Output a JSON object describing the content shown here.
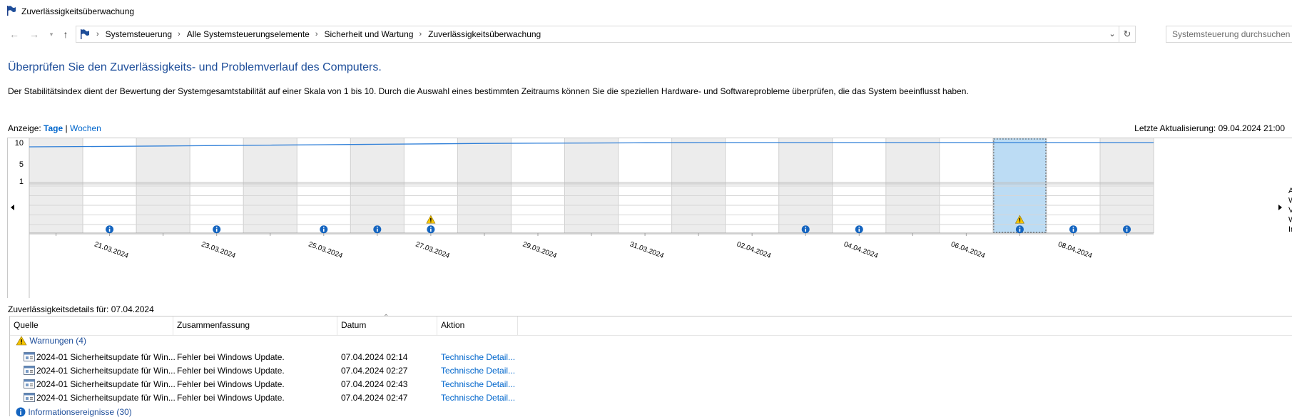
{
  "window": {
    "title": "Zuverlässigkeitsüberwachung"
  },
  "address": {
    "crumbs": [
      "Systemsteuerung",
      "Alle Systemsteuerungselemente",
      "Sicherheit und Wartung",
      "Zuverlässigkeitsüberwachung"
    ],
    "search_placeholder": "Systemsteuerung durchsuchen"
  },
  "page": {
    "heading": "Überprüfen Sie den Zuverlässigkeits- und Problemverlauf des Computers.",
    "description": "Der Stabilitätsindex dient der Bewertung der Systemgesamtstabilität auf einer Skala von 1 bis 10. Durch die Auswahl eines bestimmten Zeitraums können Sie die speziellen Hardware- und Softwareprobleme überprüfen, die das System beeinflusst haben.",
    "view_label": "Anzeige:",
    "view_days": "Tage",
    "view_sep": "|",
    "view_weeks": "Wochen",
    "last_update": "Letzte Aktualisierung: 09.04.2024 21:00"
  },
  "chart_data": {
    "type": "line",
    "title": "",
    "ylim": [
      1,
      10
    ],
    "y_ticks": [
      "10",
      "5",
      "1"
    ],
    "x_tick_labels": [
      "21.03.2024",
      "23.03.2024",
      "25.03.2024",
      "27.03.2024",
      "29.03.2024",
      "31.03.2024",
      "02.04.2024",
      "04.04.2024",
      "06.04.2024",
      "08.04.2024"
    ],
    "days": [
      "20.03",
      "21.03",
      "22.03",
      "23.03",
      "24.03",
      "25.03",
      "26.03",
      "27.03",
      "28.03",
      "29.03",
      "30.03",
      "31.03",
      "01.04",
      "02.04",
      "03.04",
      "04.04",
      "05.04",
      "06.04",
      "07.04",
      "08.04",
      "09.04"
    ],
    "stability_index": [
      9.0,
      9.1,
      9.2,
      9.3,
      9.4,
      9.5,
      9.6,
      9.7,
      9.8,
      9.85,
      9.9,
      9.95,
      10,
      10,
      10,
      10,
      10,
      10,
      10,
      10,
      10
    ],
    "selected_day": "07.04",
    "warning_days": [
      "27.03",
      "07.04"
    ],
    "info_days": [
      "21.03",
      "23.03",
      "25.03",
      "26.03",
      "27.03",
      "03.04",
      "04.04",
      "07.04",
      "08.04",
      "09.04"
    ],
    "row_labels_right": [
      "A",
      "W",
      "V",
      "W",
      "In"
    ]
  },
  "details": {
    "label": "Zuverlässigkeitsdetails für: 07.04.2024",
    "columns": [
      "Quelle",
      "Zusammenfassung",
      "Datum",
      "Aktion"
    ],
    "warnings_group": "Warnungen (4)",
    "rows": [
      {
        "source": "2024-01 Sicherheitsupdate für Win...",
        "summary": "Fehler bei Windows Update.",
        "date": "07.04.2024 02:14",
        "action": "Technische Detail..."
      },
      {
        "source": "2024-01 Sicherheitsupdate für Win...",
        "summary": "Fehler bei Windows Update.",
        "date": "07.04.2024 02:27",
        "action": "Technische Detail..."
      },
      {
        "source": "2024-01 Sicherheitsupdate für Win...",
        "summary": "Fehler bei Windows Update.",
        "date": "07.04.2024 02:43",
        "action": "Technische Detail..."
      },
      {
        "source": "2024-01 Sicherheitsupdate für Win...",
        "summary": "Fehler bei Windows Update.",
        "date": "07.04.2024 02:47",
        "action": "Technische Detail..."
      }
    ],
    "info_group": "Informationsereignisse (30)"
  },
  "colors": {
    "accent": "#1e4e9a",
    "link": "#0066cc",
    "line": "#2f7fd8",
    "selection": "#bcdcf4",
    "info": "#1565c0",
    "warning": "#f5c400"
  }
}
